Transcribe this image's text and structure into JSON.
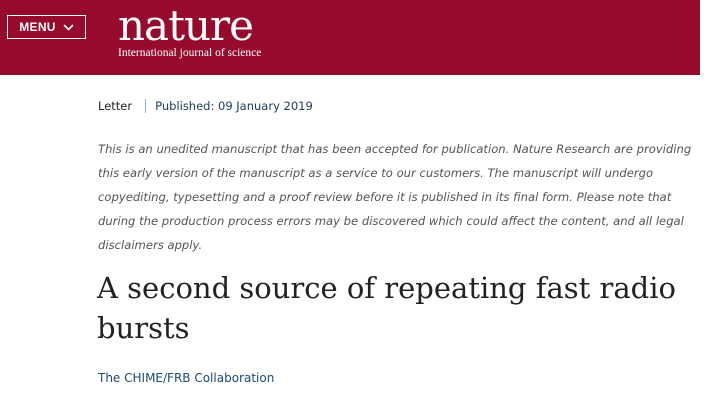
{
  "header": {
    "menu_label": "MENU",
    "logo_wordmark": "nature",
    "logo_tagline": "International journal of science",
    "background_color": "#960a2c"
  },
  "article": {
    "type": "Letter",
    "published": "Published: 09 January 2019",
    "notice": "This is an unedited manuscript that has been accepted for publication. Nature Research are providing this early version of the manuscript as a service to our customers. The manuscript will undergo copyediting, typesetting and a proof review before it is published in its final form. Please note that during the production process errors may be discovered which could affect the content, and all legal disclaimers apply.",
    "title": "A second source of repeating fast radio bursts",
    "authors": "The CHIME/FRB Collaboration"
  },
  "icons": {
    "menu_chevron": "chevron-down-icon"
  }
}
